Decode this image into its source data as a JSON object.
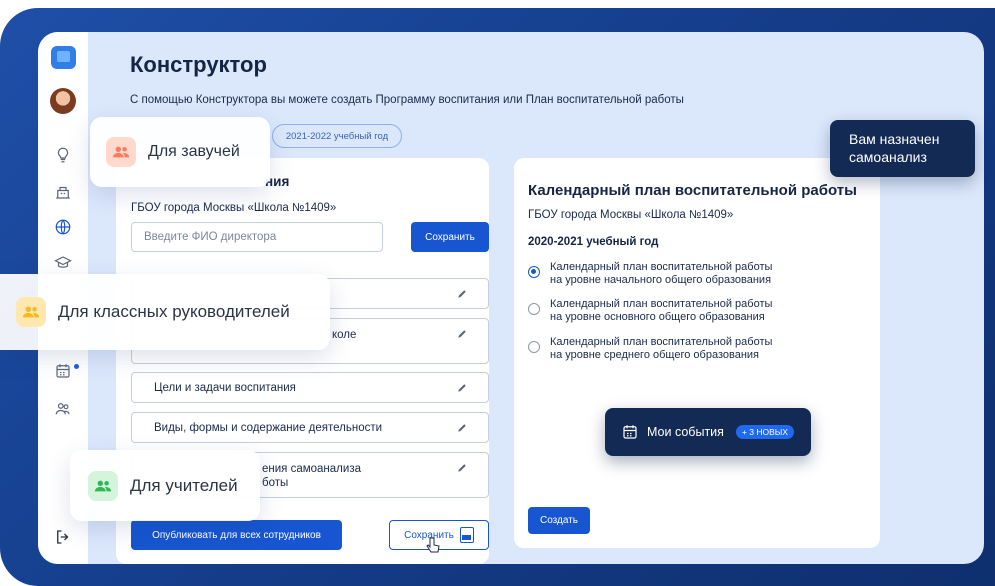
{
  "page": {
    "title": "Конструктор",
    "subtitle": "С помощью Конструктора вы можете создать Программу воспитания или План воспитательной работы",
    "year_chip": "2021-2022 учебный год"
  },
  "left_card": {
    "heading_partial": "ния",
    "school": "ГБОУ города Москвы «Школа №1409»",
    "director_placeholder": "Введите ФИО директора",
    "save_label": "Сохранить",
    "sections": [
      {
        "label": ""
      },
      {
        "label_line1": "коле",
        "label_line2": ""
      },
      {
        "label": "Цели и задачи воспитания"
      },
      {
        "label": "Виды, формы и содержание деятельности"
      },
      {
        "label_line1": "ения самоанализа",
        "label_line2": "боты"
      }
    ],
    "publish_label": "Опубликовать для всех сотрудников",
    "save_pdf_label": "Сохранить"
  },
  "right_card": {
    "title": "Календарный план воспитательной работы",
    "school": "ГБОУ города Москвы «Школа №1409»",
    "year": "2020-2021 учебный год",
    "options": [
      {
        "line1": "Календарный план воспитательной работы",
        "line2": "на уровне начального общего образования",
        "checked": true
      },
      {
        "line1": "Календарный план воспитательной работы",
        "line2": "на уровне основного общего образования",
        "checked": false
      },
      {
        "line1": "Календарный план воспитательной работы",
        "line2": "на уровне среднего общего образования",
        "checked": false
      }
    ],
    "create_label": "Создать"
  },
  "toasts": {
    "self_analysis": {
      "line1": "Вам назначен",
      "line2": "самоанализ"
    },
    "events": {
      "label": "Мои события",
      "badge": "+ 3 НОВЫХ"
    }
  },
  "audiences": {
    "deputies": "Для завучей",
    "class_teachers": "Для классных руководителей",
    "teachers": "Для учителей"
  },
  "colors": {
    "primary": "#1756d0",
    "dark_toast": "#132a55",
    "app_bg": "#dbe7fb",
    "deputies_icon": "#ff7a5c",
    "class_teachers_icon": "#f5b820",
    "teachers_icon": "#2fb55a"
  },
  "icons": {
    "sidebar": [
      "logo-icon",
      "avatar",
      "lightbulb-icon",
      "building-icon",
      "globe-icon",
      "graduation-cap-icon",
      "calendar-icon",
      "users-icon",
      "logout-icon"
    ]
  }
}
